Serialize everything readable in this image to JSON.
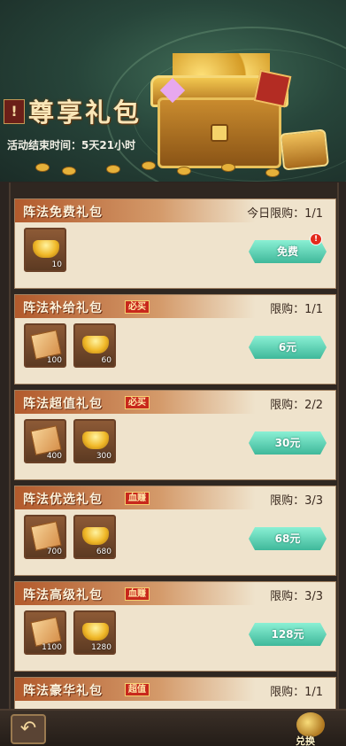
{
  "header": {
    "title_badge": "!",
    "title": "尊享礼包",
    "countdown_label": "活动结束时间：",
    "countdown_value": "5天21小时"
  },
  "packs": [
    {
      "name": "阵法免费礼包",
      "tag": "",
      "limit": "今日限购：1/1",
      "items": [
        {
          "kind": "ingot-icon",
          "qty": "10"
        }
      ],
      "button": "免费",
      "has_alert": true,
      "alert": "!"
    },
    {
      "name": "阵法补给礼包",
      "tag": "必买",
      "limit": "限购：1/1",
      "items": [
        {
          "kind": "scroll-icon",
          "qty": "100"
        },
        {
          "kind": "ingot-icon",
          "qty": "60"
        }
      ],
      "button": "6元",
      "has_alert": false
    },
    {
      "name": "阵法超值礼包",
      "tag": "必买",
      "limit": "限购：2/2",
      "items": [
        {
          "kind": "scroll-icon",
          "qty": "400"
        },
        {
          "kind": "ingot-icon",
          "qty": "300"
        }
      ],
      "button": "30元",
      "has_alert": false
    },
    {
      "name": "阵法优选礼包",
      "tag": "血赚",
      "limit": "限购：3/3",
      "items": [
        {
          "kind": "scroll-icon",
          "qty": "700"
        },
        {
          "kind": "ingot-icon",
          "qty": "680"
        }
      ],
      "button": "68元",
      "has_alert": false
    },
    {
      "name": "阵法高级礼包",
      "tag": "血赚",
      "limit": "限购：3/3",
      "items": [
        {
          "kind": "scroll-icon",
          "qty": "1100"
        },
        {
          "kind": "ingot-icon",
          "qty": "1280"
        }
      ],
      "button": "128元",
      "has_alert": false
    },
    {
      "name": "阵法豪华礼包",
      "tag": "超值",
      "limit": "限购：1/1",
      "items": [],
      "button": "",
      "has_alert": false
    }
  ],
  "bottom": {
    "back_icon": "back-arrow-icon",
    "exchange_label": "兑换"
  },
  "colors": {
    "card_bg": "#efe3cc",
    "button": "#3fb89a",
    "tag_red": "#c8281c"
  }
}
